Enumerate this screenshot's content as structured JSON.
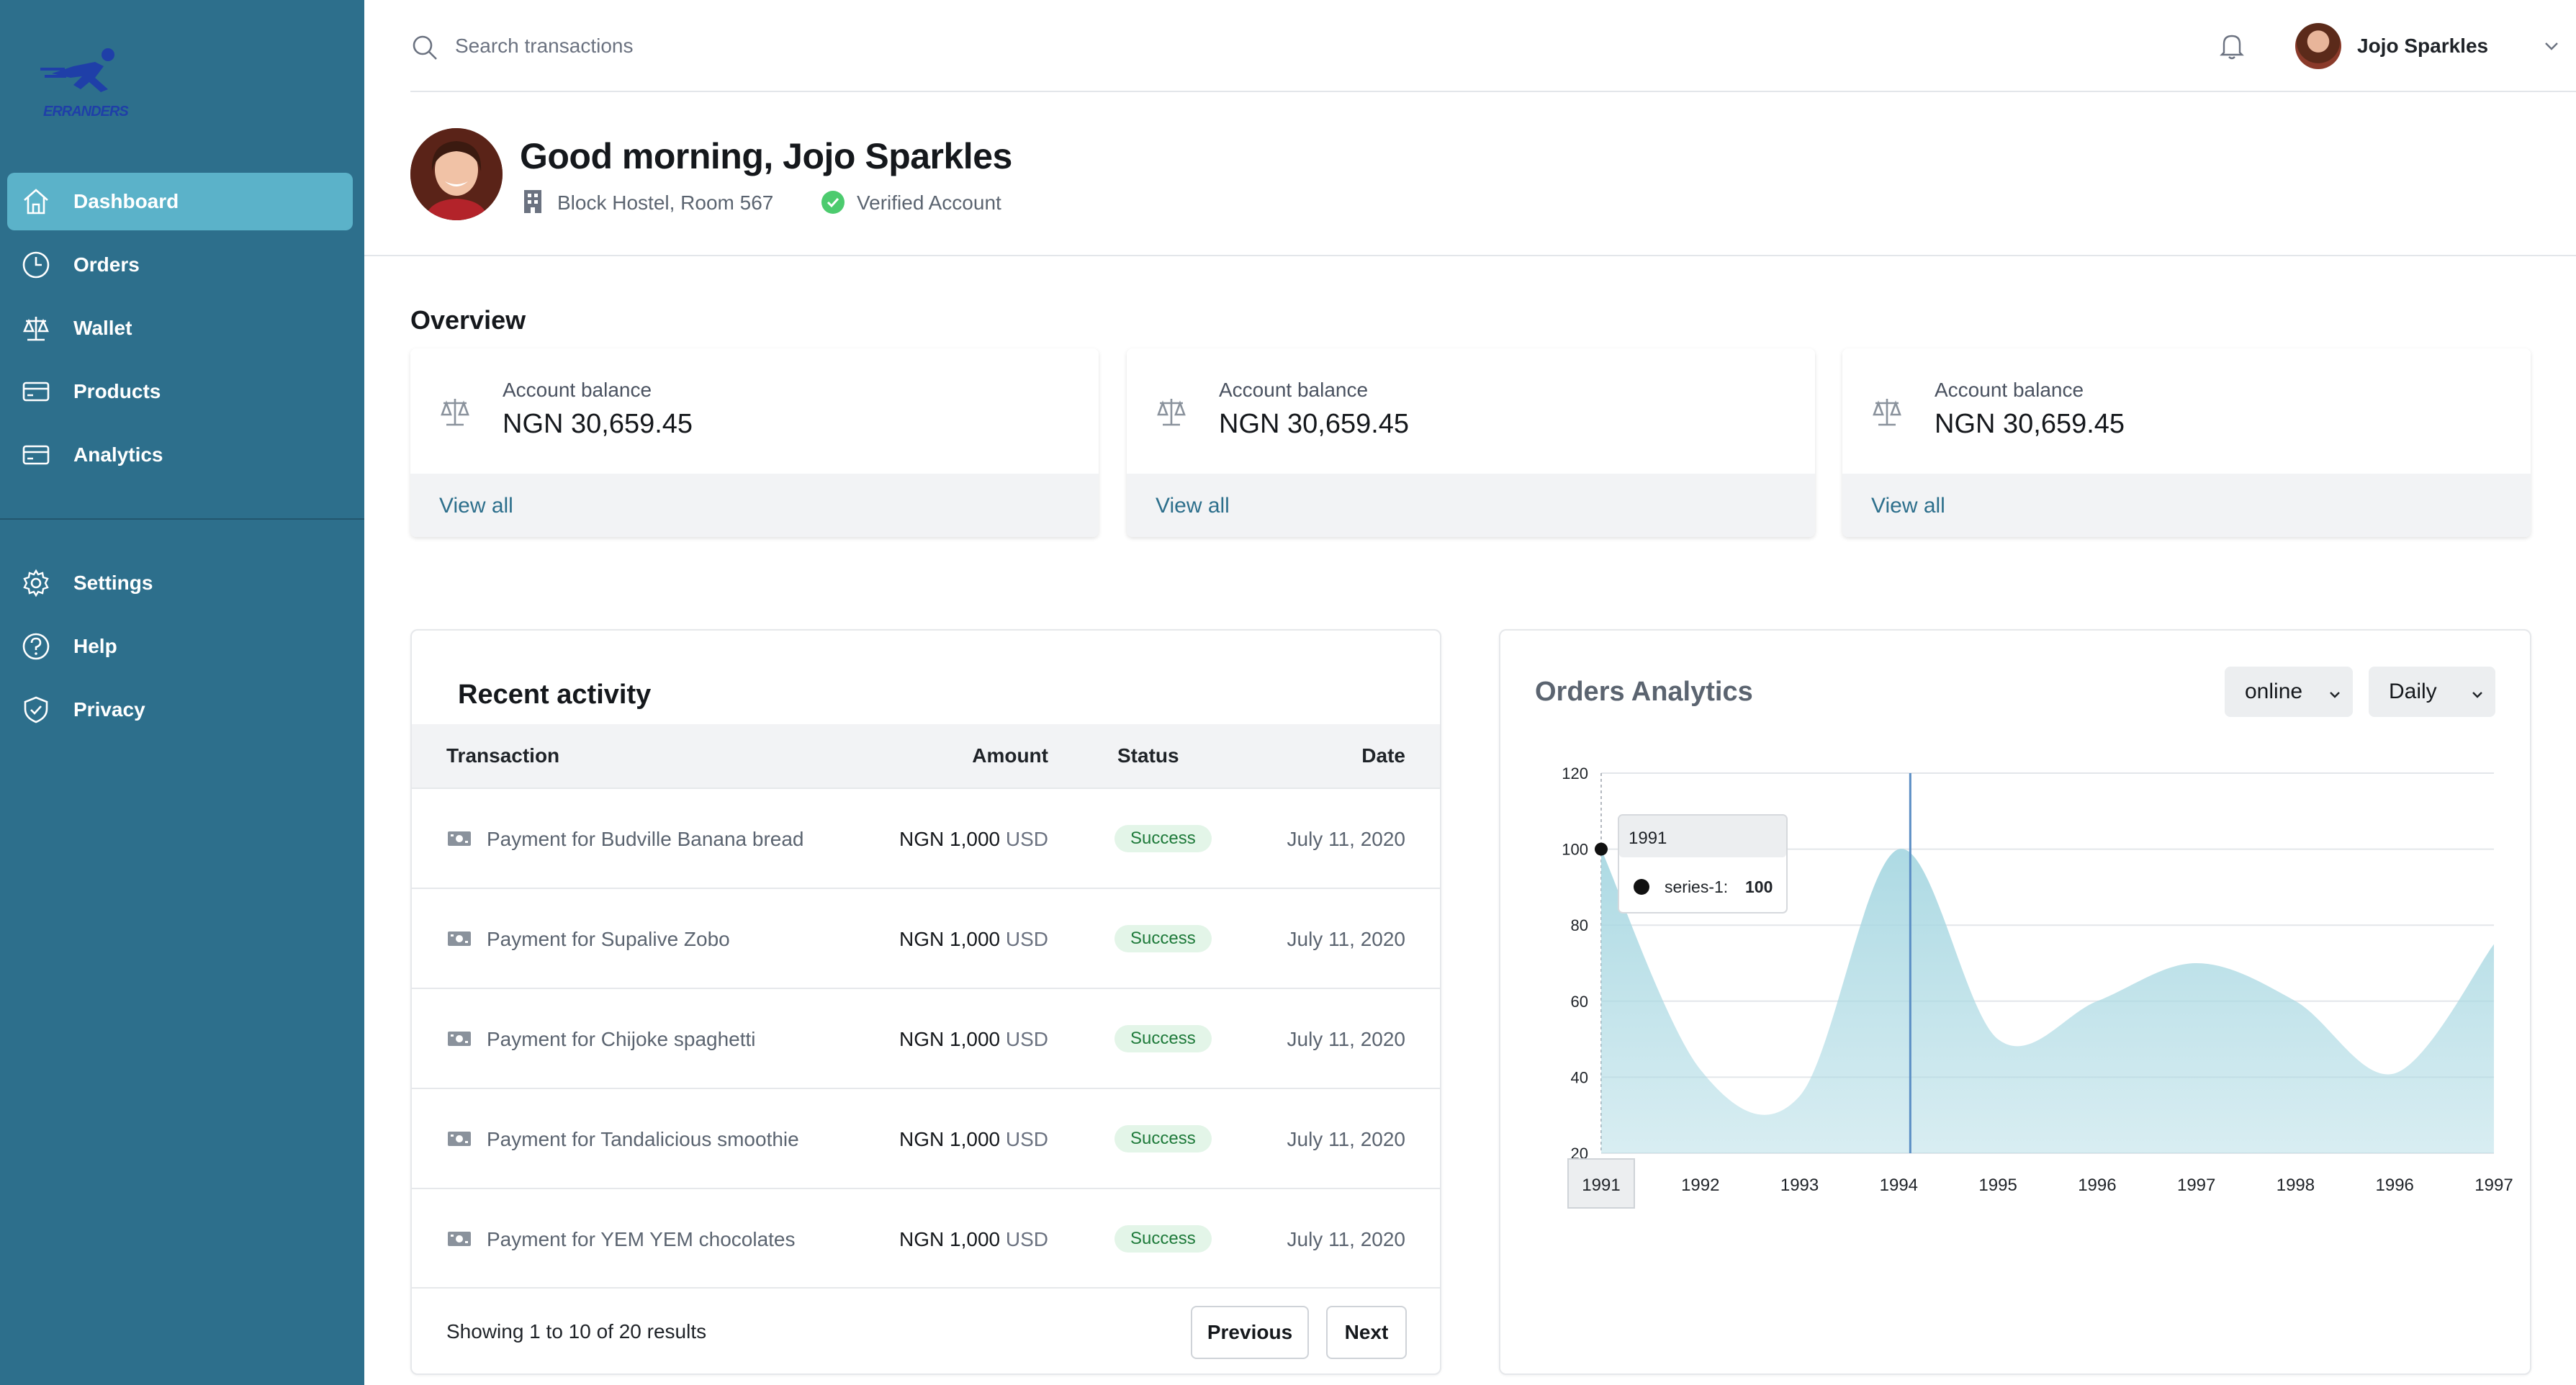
{
  "brand": {
    "logo_text": "ERRANDERS"
  },
  "sidebar": {
    "items": [
      {
        "label": "Dashboard",
        "icon": "home-icon",
        "active": true
      },
      {
        "label": "Orders",
        "icon": "clock-icon",
        "active": false
      },
      {
        "label": "Wallet",
        "icon": "scale-icon",
        "active": false
      },
      {
        "label": "Products",
        "icon": "card-icon",
        "active": false
      },
      {
        "label": "Analytics",
        "icon": "card-icon",
        "active": false
      }
    ],
    "secondary": [
      {
        "label": "Settings",
        "icon": "gear-icon"
      },
      {
        "label": "Help",
        "icon": "help-icon"
      },
      {
        "label": "Privacy",
        "icon": "shield-icon"
      }
    ]
  },
  "topbar": {
    "search_placeholder": "Search transactions",
    "user_name": "Jojo Sparkles"
  },
  "header": {
    "greeting": "Good morning, Jojo Sparkles",
    "location": "Block Hostel, Room 567",
    "verification": "Verified Account"
  },
  "overview": {
    "title": "Overview",
    "cards": [
      {
        "label": "Account balance",
        "value": "NGN 30,659.45",
        "link": "View all"
      },
      {
        "label": "Account balance",
        "value": "NGN 30,659.45",
        "link": "View all"
      },
      {
        "label": "Account balance",
        "value": "NGN 30,659.45",
        "link": "View all"
      }
    ]
  },
  "recent_activity": {
    "title": "Recent activity",
    "columns": [
      "Transaction",
      "Amount",
      "Status",
      "Date"
    ],
    "rows": [
      {
        "description": "Payment for Budville Banana bread",
        "amount_prefix": "NGN",
        "amount": "1,000",
        "currency": "USD",
        "status": "Success",
        "date": "July 11, 2020"
      },
      {
        "description": "Payment for Supalive Zobo",
        "amount_prefix": "NGN",
        "amount": "1,000",
        "currency": "USD",
        "status": "Success",
        "date": "July 11, 2020"
      },
      {
        "description": "Payment for Chijoke spaghetti",
        "amount_prefix": "NGN",
        "amount": "1,000",
        "currency": "USD",
        "status": "Success",
        "date": "July 11, 2020"
      },
      {
        "description": "Payment for Tandalicious smoothie",
        "amount_prefix": "NGN",
        "amount": "1,000",
        "currency": "USD",
        "status": "Success",
        "date": "July 11, 2020"
      },
      {
        "description": "Payment for YEM YEM chocolates",
        "amount_prefix": "NGN",
        "amount": "1,000",
        "currency": "USD",
        "status": "Success",
        "date": "July 11, 2020"
      }
    ],
    "showing": "Showing 1 to 10 of 20 results",
    "prev_label": "Previous",
    "next_label": "Next"
  },
  "analytics": {
    "title": "Orders Analytics",
    "channel": "online",
    "period": "Daily",
    "tooltip": {
      "title": "1991",
      "series": "series-1:",
      "value": "100"
    },
    "chart_data": {
      "type": "area",
      "x": [
        "1991",
        "1992",
        "1993",
        "1994",
        "1995",
        "1996",
        "1997",
        "1998",
        "1996",
        "1997"
      ],
      "series": [
        {
          "name": "series-1",
          "values": [
            100,
            42,
            35,
            100,
            50,
            60,
            70,
            60,
            41,
            75
          ]
        }
      ],
      "ylim": [
        20,
        120
      ],
      "yticks": [
        20,
        40,
        60,
        80,
        100,
        120
      ],
      "grid": true,
      "color": "#a9d8e2"
    }
  },
  "colors": {
    "sidebar": "#2d6f8c",
    "active": "#5bb2c9",
    "success_bg": "#e3f5e8",
    "success_text": "#1e7a3a"
  }
}
